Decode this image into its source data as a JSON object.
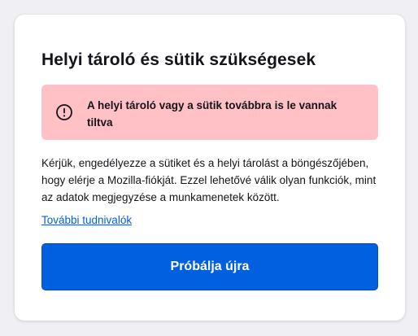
{
  "dialog": {
    "title": "Helyi tároló és sütik szükségesek",
    "alert": {
      "icon": "error-circle-icon",
      "text": "A helyi tároló vagy a sütik továbbra is le vannak tiltva",
      "background_color": "#ffc0c6"
    },
    "body_text": "Kérjük, engedélyezze a sütiket és a helyi tárolást a böngészőjében, hogy elérje a Mozilla-fiókját. Ezzel lehetővé válik olyan funkciók, mint az adatok megjegyzése a munkamenetek között.",
    "learn_more_link": "További tudnivalók",
    "retry_button": "Próbálja újra"
  },
  "colors": {
    "accent": "#0060df",
    "page_background": "#f0f0f4",
    "card_background": "#ffffff",
    "text": "#15141a"
  }
}
